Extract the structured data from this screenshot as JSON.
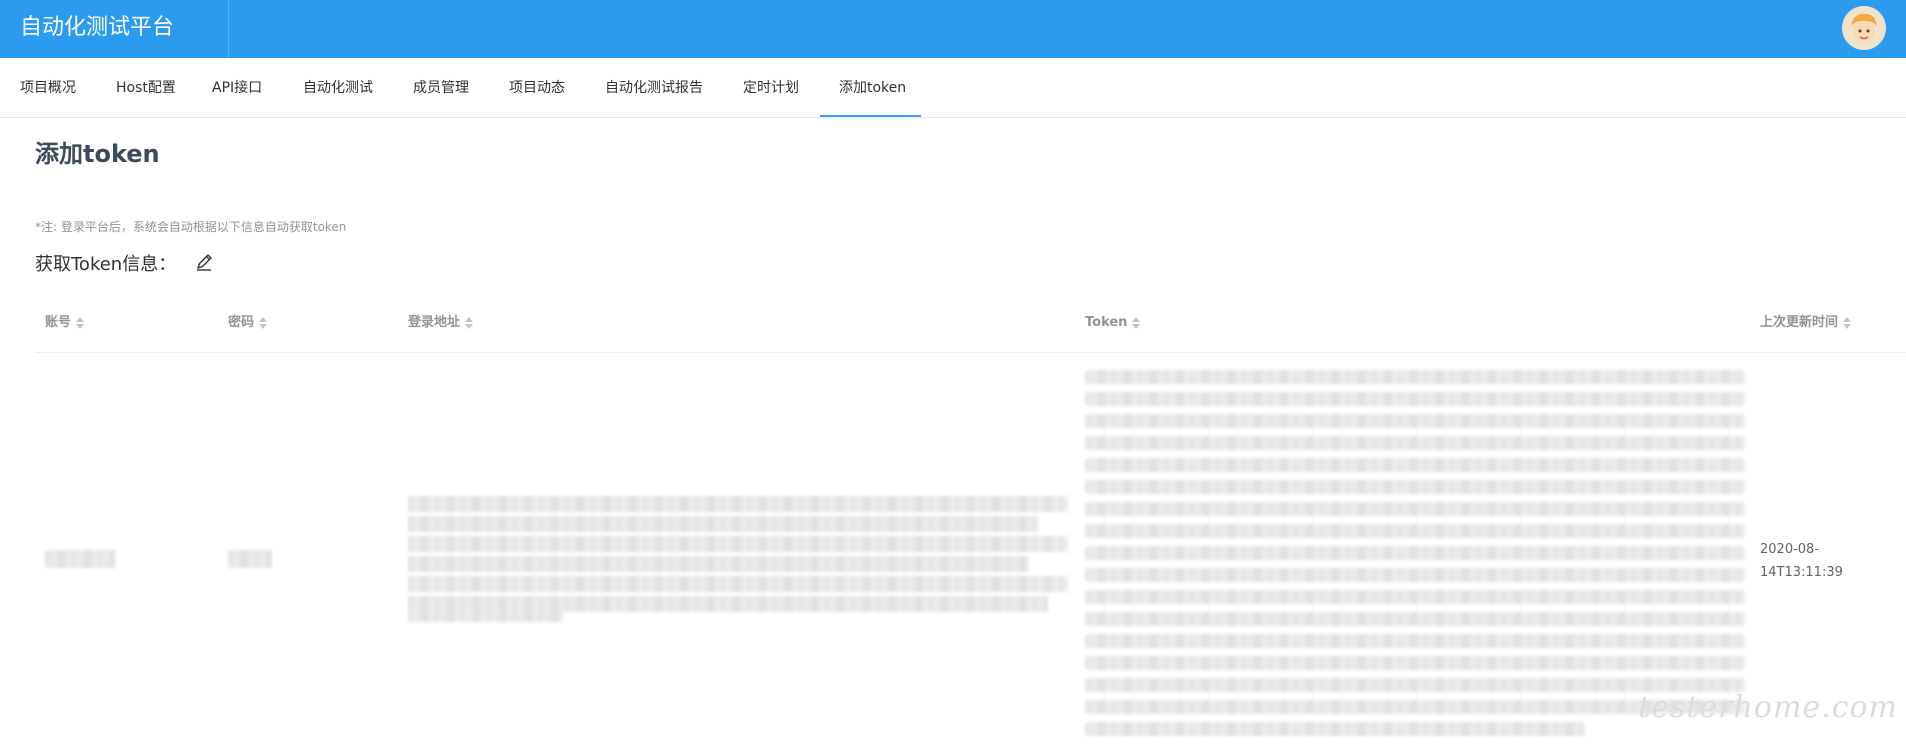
{
  "header": {
    "title": "自动化测试平台"
  },
  "tabs": [
    {
      "label": "项目概况"
    },
    {
      "label": "Host配置"
    },
    {
      "label": "API接口"
    },
    {
      "label": "自动化测试"
    },
    {
      "label": "成员管理"
    },
    {
      "label": "项目动态"
    },
    {
      "label": "自动化测试报告"
    },
    {
      "label": "定时计划"
    },
    {
      "label": "添加token"
    }
  ],
  "active_tab": "添加token",
  "page": {
    "title": "添加token",
    "note": "*注: 登录平台后，系统会自动根据以下信息自动获取token",
    "section_title": "获取Token信息："
  },
  "table": {
    "columns": [
      "账号",
      "密码",
      "登录地址",
      "Token",
      "上次更新时间"
    ],
    "rows": [
      {
        "account": "",
        "password": "",
        "login_url": "",
        "token": "",
        "updated_at": "2020-08-14T13:11:39"
      }
    ]
  },
  "watermark": "testerhome.com",
  "colors": {
    "header_bg": "#2b9bf0",
    "tab_active_underline": "#409eff",
    "table_header_text": "#909399"
  }
}
